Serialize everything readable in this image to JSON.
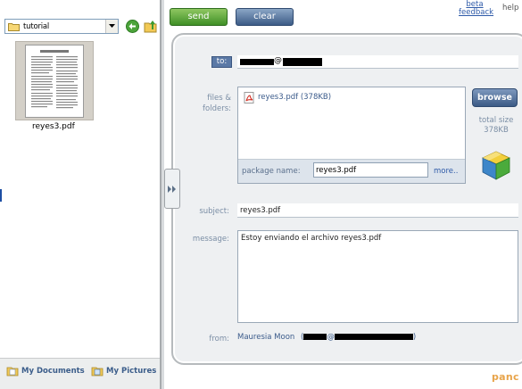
{
  "browser": {
    "folder": "tutorial",
    "files": [
      {
        "name": "reyes3.pdf"
      }
    ],
    "shortcuts": [
      {
        "label": "My Documents"
      },
      {
        "label": "My Pictures"
      }
    ]
  },
  "toolbar": {
    "send_label": "send",
    "clear_label": "clear",
    "beta_label": "beta feedback",
    "help_label": "help"
  },
  "form": {
    "to_label": "to:",
    "to_value_domain": "@",
    "files_label": "files & folders:",
    "attached_file": "reyes3.pdf (378KB)",
    "package_name_label": "package name:",
    "package_name_value": "reyes3.pdf",
    "more_label": "more..",
    "browse_label": "browse",
    "total_size_label": "total size",
    "total_size_value": "378KB",
    "subject_label": "subject:",
    "subject_value": "reyes3.pdf",
    "message_label": "message:",
    "message_value": "Estoy enviando el archivo reyes3.pdf",
    "from_label": "from:",
    "from_name": "Mauresia Moon",
    "from_email_prefix": "(",
    "from_email_at": "@",
    "from_email_suffix": ")"
  },
  "brand": "panc",
  "colors": {
    "send": "#3f8f26",
    "accent_blue": "#3c5b86",
    "link": "#2e5aa8",
    "label": "#7b8ea5",
    "brand": "#e8a44a"
  },
  "icons": [
    "folder-icon",
    "back-arrow-icon",
    "up-folder-icon",
    "pdf-icon",
    "package-cube-icon",
    "expand-arrows-icon",
    "document-icon",
    "picture-icon"
  ]
}
